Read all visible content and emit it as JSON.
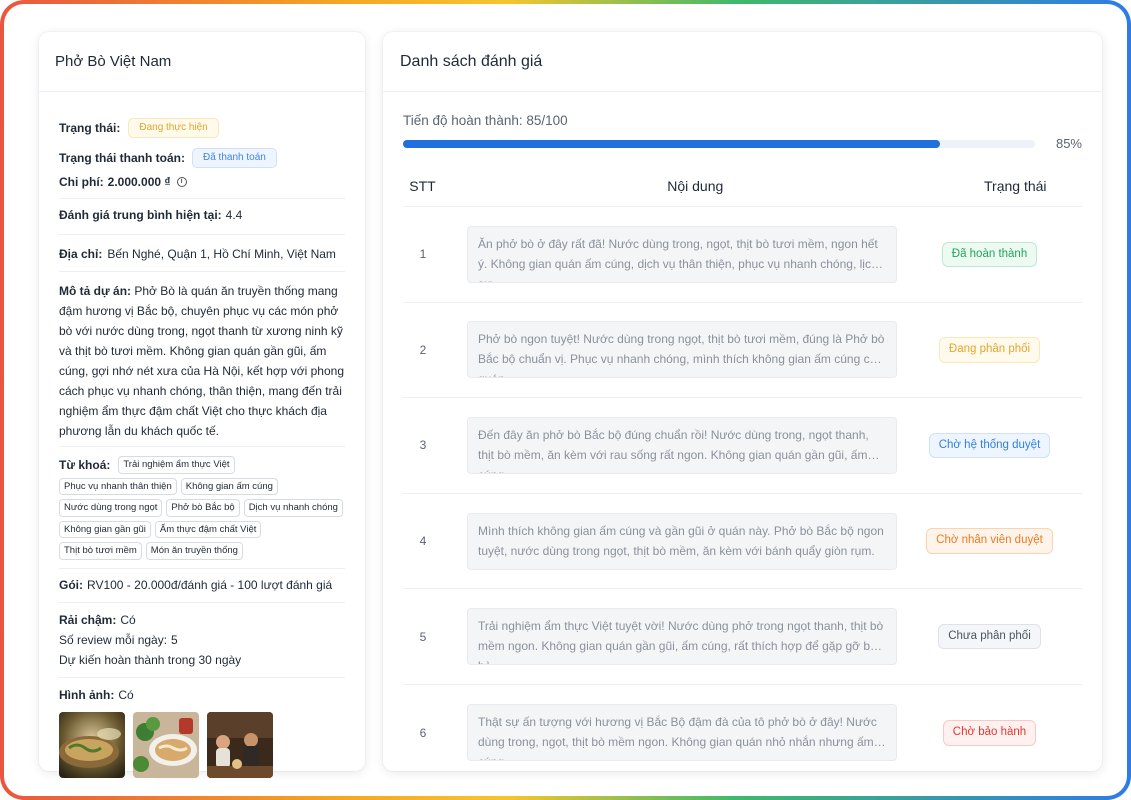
{
  "project": {
    "title": "Phở Bò Việt Nam",
    "status_label": "Trạng thái:",
    "status_value": "Đang thực hiện",
    "payment_label": "Trạng thái thanh toán:",
    "payment_value": "Đã thanh toán",
    "cost_label": "Chi phí:",
    "cost_value": "2.000.000 ₫",
    "cost_info_glyph": "i",
    "rating_label": "Đánh giá trung bình hiện tại:",
    "rating_value": "4.4",
    "address_label": "Địa chỉ:",
    "address_value": "Bến Nghé, Quận 1, Hồ Chí Minh, Việt Nam",
    "desc_label": "Mô tả dự án:",
    "desc_value": "Phở Bò là quán ăn truyền thống mang đậm hương vị Bắc bộ, chuyên phục vụ các món phở bò với nước dùng trong, ngọt thanh từ xương ninh kỹ và thịt bò tươi mềm. Không gian quán gần gũi, ấm cúng, gợi nhớ nét xưa của Hà Nội, kết hợp với phong cách phục vụ nhanh chóng, thân thiện, mang đến trải nghiệm ẩm thực đậm chất Việt cho thực khách địa phương lẫn du khách quốc tế.",
    "keywords_label": "Từ khoá:",
    "keywords": [
      "Trải nghiệm ẩm thực Việt",
      "Phục vụ nhanh thân thiện",
      "Không gian ấm cúng",
      "Nước dùng trong ngọt",
      "Phở bò Bắc bộ",
      "Dịch vụ nhanh chóng",
      "Không gian gần gũi",
      "Ẩm thực đậm chất Việt",
      "Thịt bò tươi mềm",
      "Món ăn truyền thống"
    ],
    "package_label": "Gói:",
    "package_value": "RV100 - 20.000đ/đánh giá - 100 lượt đánh giá",
    "drip_label": "Rải chậm:",
    "drip_value": "Có",
    "daily_label": "Số review mỗi ngày:",
    "daily_value": "5",
    "eta_text": "Dự kiến hoàn thành trong 30 ngày",
    "images_label": "Hình ảnh:",
    "images_value": "Có"
  },
  "reviews": {
    "title": "Danh sách đánh giá",
    "progress_label": "Tiến độ hoàn thành: 85/100",
    "progress_fraction": 0.85,
    "progress_pct": "85%",
    "progress_color": "#1f6fde",
    "columns": {
      "stt": "STT",
      "content": "Nội dung",
      "status": "Trạng thái"
    },
    "rows": [
      {
        "stt": "1",
        "content": "Ăn phở bò ở đây rất đã! Nước dùng trong, ngọt, thịt bò tươi mềm, ngon hết ý. Không gian quán ấm cúng, dịch vụ thân thiện, phục vụ nhanh chóng, lịch sự.",
        "status": "Đã hoàn thành",
        "color": "#22a55b",
        "bg": "#edfaf2",
        "border": "#bfe9cf"
      },
      {
        "stt": "2",
        "content": "Phở bò ngon tuyệt! Nước dùng trong ngọt, thịt bò tươi mềm, đúng là Phở bò Bắc bộ chuẩn vị. Phục vụ nhanh chóng, mình thích không gian ấm cúng của quán.",
        "status": "Đang phân phối",
        "color": "#e3a62f",
        "bg": "#fffaeb",
        "border": "#fde7b4"
      },
      {
        "stt": "3",
        "content": "Đến đây ăn phở bò Bắc bộ đúng chuẩn rồi! Nước dùng trong, ngọt thanh, thịt bò mềm, ăn kèm với rau sống rất ngon. Không gian quán gần gũi, ấm cúng.",
        "status": "Chờ hệ thống duyệt",
        "color": "#2f82e0",
        "bg": "#eef5ff",
        "border": "#cfe1fb"
      },
      {
        "stt": "4",
        "content": "Mình thích không gian ấm cúng và gần gũi ở quán này. Phở bò Bắc bộ ngon tuyệt, nước dùng trong ngọt, thịt bò mềm, ăn kèm với bánh quẩy giòn rụm.",
        "status": "Chờ nhân viên duyệt",
        "color": "#ea7a22",
        "bg": "#fff4ea",
        "border": "#fbd3b0"
      },
      {
        "stt": "5",
        "content": "Trải nghiệm ẩm thực Việt tuyệt vời! Nước dùng phở trong ngọt thanh, thịt bò mềm ngon. Không gian quán gần gũi, ấm cúng, rất thích hợp để gặp gỡ bạn bè.",
        "status": "Chưa phân phối",
        "color": "#4b5563",
        "bg": "#f4f6f9",
        "border": "#dde2e8"
      },
      {
        "stt": "6",
        "content": "Thật sự ấn tượng với hương vị Bắc Bộ đậm đà của tô phở bò ở đây! Nước dùng trong, ngọt, thịt bò mềm ngon. Không gian quán nhỏ nhắn nhưng ấm cúng.",
        "status": "Chờ bảo hành",
        "color": "#e0392f",
        "bg": "#fff1f0",
        "border": "#f8c9c5"
      }
    ]
  }
}
